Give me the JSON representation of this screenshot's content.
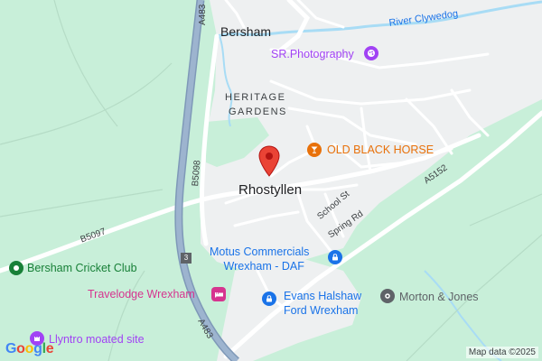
{
  "places": {
    "bersham": "Bersham",
    "heritage_gardens_1": "HERITAGE",
    "heritage_gardens_2": "GARDENS",
    "rhostyllen": "Rhostyllen",
    "river": "River Clywedog"
  },
  "roads": {
    "a483_top": "A483",
    "a483_bottom": "A483",
    "b5098": "B5098",
    "b5097": "B5097",
    "a5152": "A5152",
    "school_st": "School St",
    "spring_rd": "Spring Rd",
    "shield_3": "3"
  },
  "pois": {
    "sr_photography": "SR.Photography",
    "old_black_horse": "OLD BLACK HORSE",
    "motus_1": "Motus Commercials",
    "motus_2": "Wrexham - DAF",
    "bersham_cricket": "Bersham Cricket Club",
    "travelodge": "Travelodge Wrexham",
    "evans_1": "Evans Halshaw",
    "evans_2": "Ford Wrexham",
    "morton": "Morton & Jones",
    "llyntro": "Llyntro moated site"
  },
  "attribution": "Map data ©2025",
  "logo": "Google",
  "colors": {
    "park_green": "#c8efd9",
    "urban_grey": "#f1f3f4",
    "motorway": "#8ea8c4",
    "water": "#a8dcf5",
    "marker_red": "#ea4335",
    "poi_purple": "#a142f4",
    "poi_blue": "#1a73e8",
    "poi_orange": "#e8710a",
    "poi_pink": "#d6348f",
    "poi_green": "#188038",
    "poi_grey": "#5f6368"
  }
}
